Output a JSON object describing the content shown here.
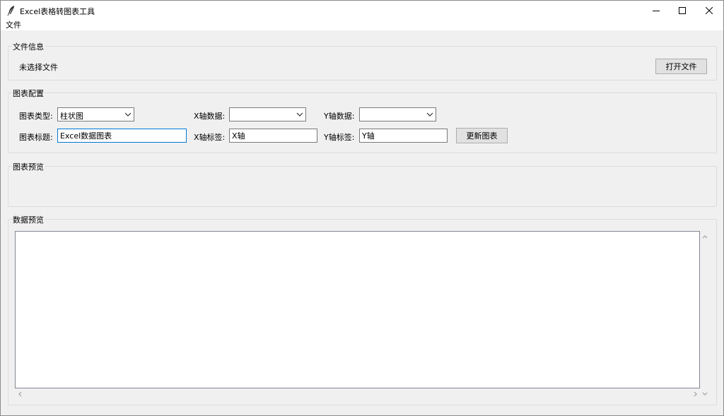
{
  "window": {
    "title": "Excel表格转图表工具",
    "controls": {
      "minimize": "minimize-icon",
      "maximize": "maximize-icon",
      "close": "close-icon"
    }
  },
  "menubar": {
    "items": [
      {
        "label": "文件"
      }
    ]
  },
  "file_info": {
    "group_label": "文件信息",
    "status_text": "未选择文件",
    "open_button": "打开文件"
  },
  "chart_config": {
    "group_label": "图表配置",
    "chart_type_label": "图表类型:",
    "chart_type_value": "柱状图",
    "x_data_label": "X轴数据:",
    "x_data_value": "",
    "y_data_label": "Y轴数据:",
    "y_data_value": "",
    "chart_title_label": "图表标题:",
    "chart_title_value": "Excel数据图表",
    "x_label_label": "X轴标签:",
    "x_label_value": "X轴",
    "y_label_label": "Y轴标签:",
    "y_label_value": "Y轴",
    "update_button": "更新图表"
  },
  "chart_preview": {
    "group_label": "图表预览"
  },
  "data_preview": {
    "group_label": "数据预览",
    "content": ""
  }
}
